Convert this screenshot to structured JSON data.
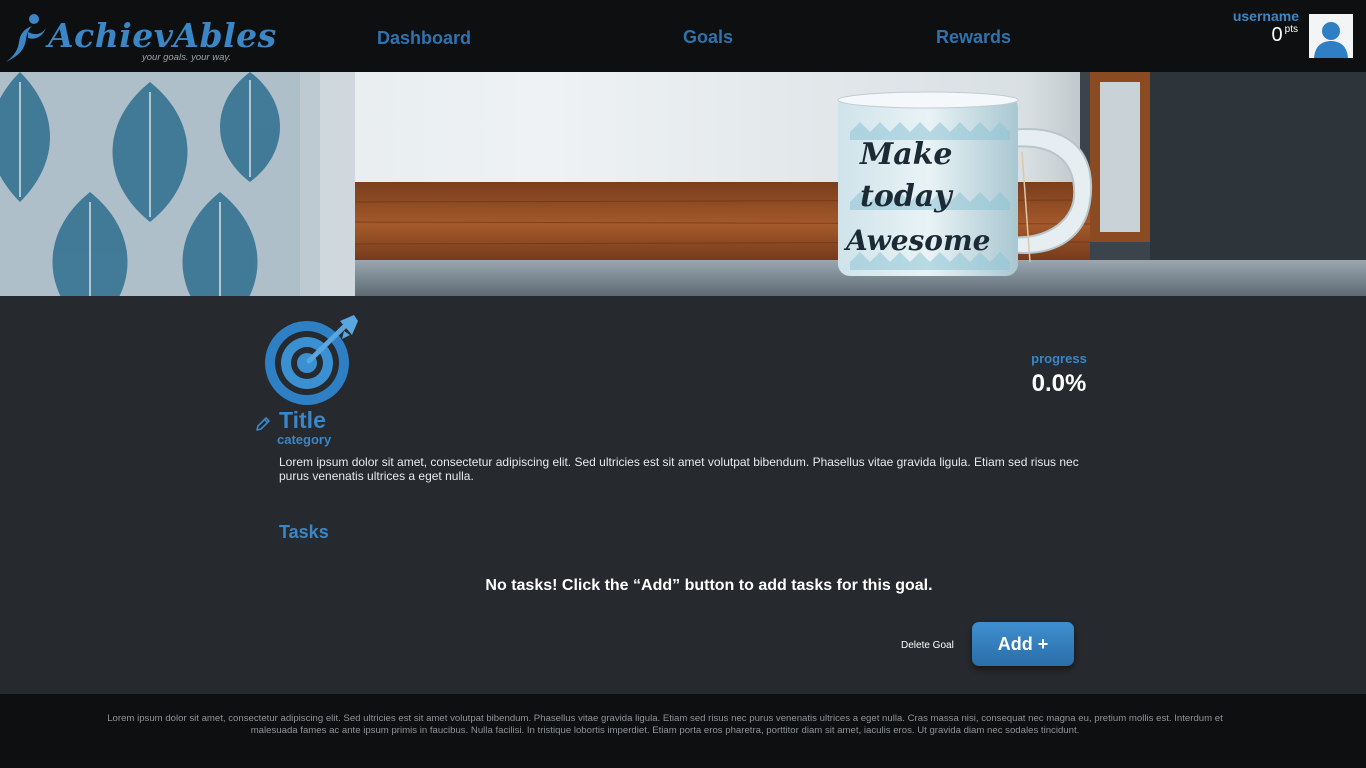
{
  "brand": {
    "name": "AchievAbles",
    "tagline": "your goals. your way.",
    "color": "#3a86c6"
  },
  "nav": {
    "links": [
      "Dashboard",
      "Goals",
      "Rewards"
    ]
  },
  "user": {
    "name": "username",
    "points": "0",
    "points_unit": "pts",
    "avatar_icon": "user-avatar-icon"
  },
  "banner": {
    "mug_text": "Make today Awesome"
  },
  "goal": {
    "title": "Title",
    "category": "category",
    "progress_label": "progress",
    "progress_value": "0.0%",
    "description": "Lorem ipsum dolor sit amet, consectetur adipiscing elit. Sed ultricies est sit amet volutpat bibendum. Phasellus vitae gravida ligula. Etiam sed risus nec purus venenatis ultrices a eget nulla.",
    "icon": "target-dart-icon",
    "edit_icon": "pencil-icon"
  },
  "tasks": {
    "heading": "Tasks",
    "empty_message": "No tasks! Click the “Add” button to add tasks for this goal.",
    "delete_label": "Delete Goal",
    "add_label": "Add +"
  },
  "footer": {
    "text": "Lorem ipsum dolor sit amet, consectetur adipiscing elit. Sed ultricies est sit amet volutpat bibendum. Phasellus vitae gravida ligula. Etiam sed risus nec purus venenatis ultrices a eget nulla. Cras massa nisi, consequat nec magna eu, pretium mollis est. Interdum et malesuada fames ac ante ipsum primis in faucibus. Nulla facilisi. In tristique lobortis imperdiet. Etiam porta eros pharetra, porttitor diam sit amet, iaculis eros. Ut gravida diam nec sodales tincidunt."
  }
}
